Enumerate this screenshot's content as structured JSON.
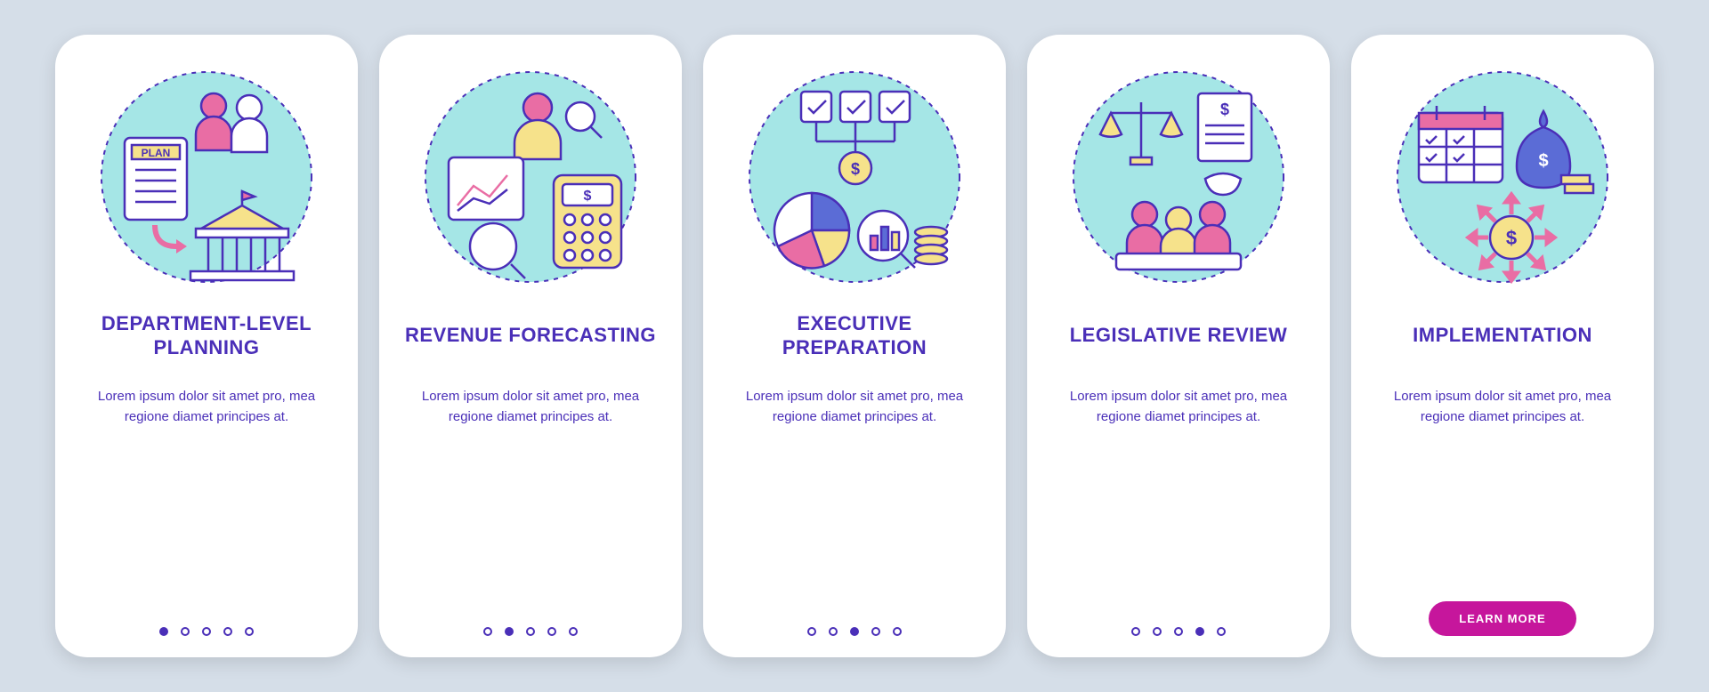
{
  "colors": {
    "background": "#d5dee8",
    "primary_text": "#4a2fb8",
    "accent_teal": "#a5e6e6",
    "accent_pink": "#e96da4",
    "accent_yellow": "#f6e28b",
    "accent_blue": "#5b6cd6",
    "cta": "#c6169c"
  },
  "body_text": "Lorem ipsum dolor sit amet pro, mea regione diamet principes at.",
  "cta_label": "LEARN MORE",
  "total_steps": 5,
  "cards": [
    {
      "title": "Department-Level Planning",
      "icon": "plan-people-building-icon",
      "step": 1
    },
    {
      "title": "Revenue Forecasting",
      "icon": "analyst-chart-calculator-icon",
      "step": 2
    },
    {
      "title": "Executive Preparation",
      "icon": "checkboxes-piechart-icon",
      "step": 3
    },
    {
      "title": "Legislative Review",
      "icon": "scales-committee-icon",
      "step": 4
    },
    {
      "title": "Implementation",
      "icon": "calendar-money-distribution-icon",
      "step": 5
    }
  ]
}
